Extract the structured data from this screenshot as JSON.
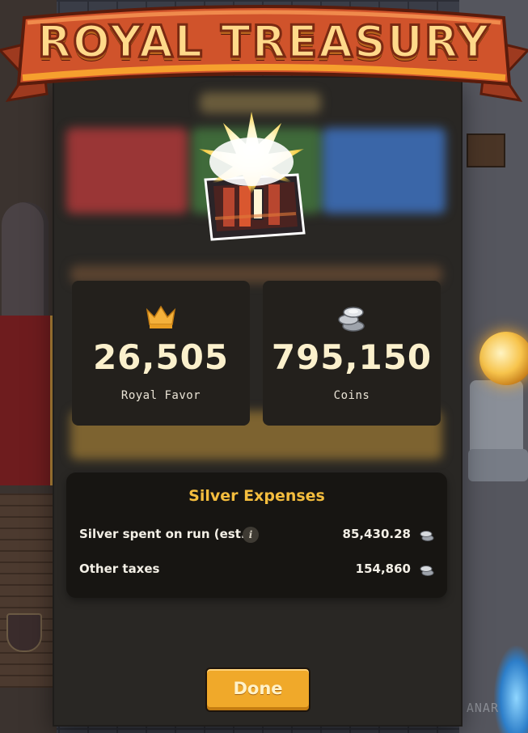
{
  "banner": {
    "title": "ROYAL TREASURY"
  },
  "stats": [
    {
      "value": "26,505",
      "label": "Royal Favor",
      "icon": "crown-icon"
    },
    {
      "value": "795,150",
      "label": "Coins",
      "icon": "silver-coins-icon"
    }
  ],
  "expenses": {
    "title": "Silver Expenses",
    "rows": [
      {
        "label": "Silver spent on run (est.)",
        "value": "85,430.28",
        "has_info": true,
        "info_glyph": "i"
      },
      {
        "label": "Other taxes",
        "value": "154,860",
        "has_info": false
      }
    ]
  },
  "actions": {
    "done_label": "Done"
  },
  "background": {
    "watermark": "ANAR"
  },
  "colors": {
    "banner_red": "#d0532b",
    "gold_text": "#f4bd3e",
    "button": "#f0a92a",
    "panel": "#292724"
  }
}
